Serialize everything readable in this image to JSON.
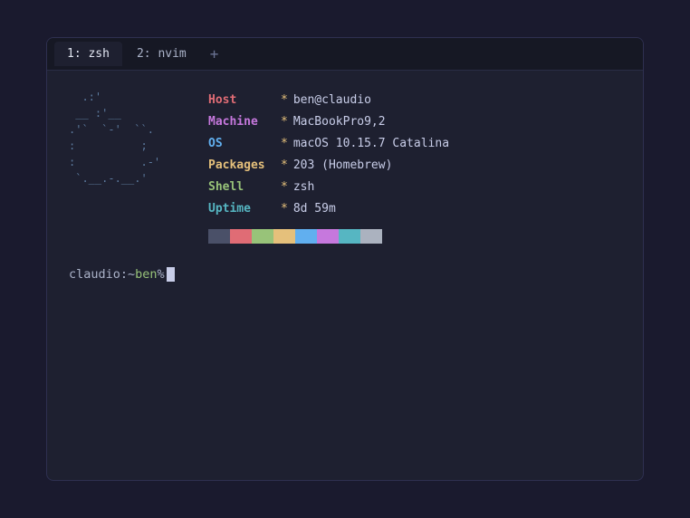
{
  "tabs": [
    {
      "id": "zsh",
      "label": "1: zsh",
      "active": true
    },
    {
      "id": "nvim",
      "label": "2: nvim",
      "active": false
    }
  ],
  "tab_new_label": "+",
  "ascii_art": "  .:'         \n __ :'__      \n.'`  `-'  ``.  \n:          ;  \n:          .-'\n `.__.-.__.'  ",
  "system_info": {
    "host": {
      "label": "Host",
      "value": "ben@claudio"
    },
    "machine": {
      "label": "Machine",
      "value": "MacBookPro9,2"
    },
    "os": {
      "label": "OS",
      "value": "macOS 10.15.7 Catalina"
    },
    "packages": {
      "label": "Packages",
      "value": "203 (Homebrew)"
    },
    "shell": {
      "label": "Shell",
      "value": "zsh"
    },
    "uptime": {
      "label": "Uptime",
      "value": "8d 59m"
    }
  },
  "color_swatches": [
    "#4a5068",
    "#e06c75",
    "#98c379",
    "#e5c07b",
    "#61afef",
    "#c678dd",
    "#56b6c2",
    "#abb2bf"
  ],
  "prompt": {
    "host": "claudio:~",
    "user": " ben",
    "symbol": " %"
  }
}
